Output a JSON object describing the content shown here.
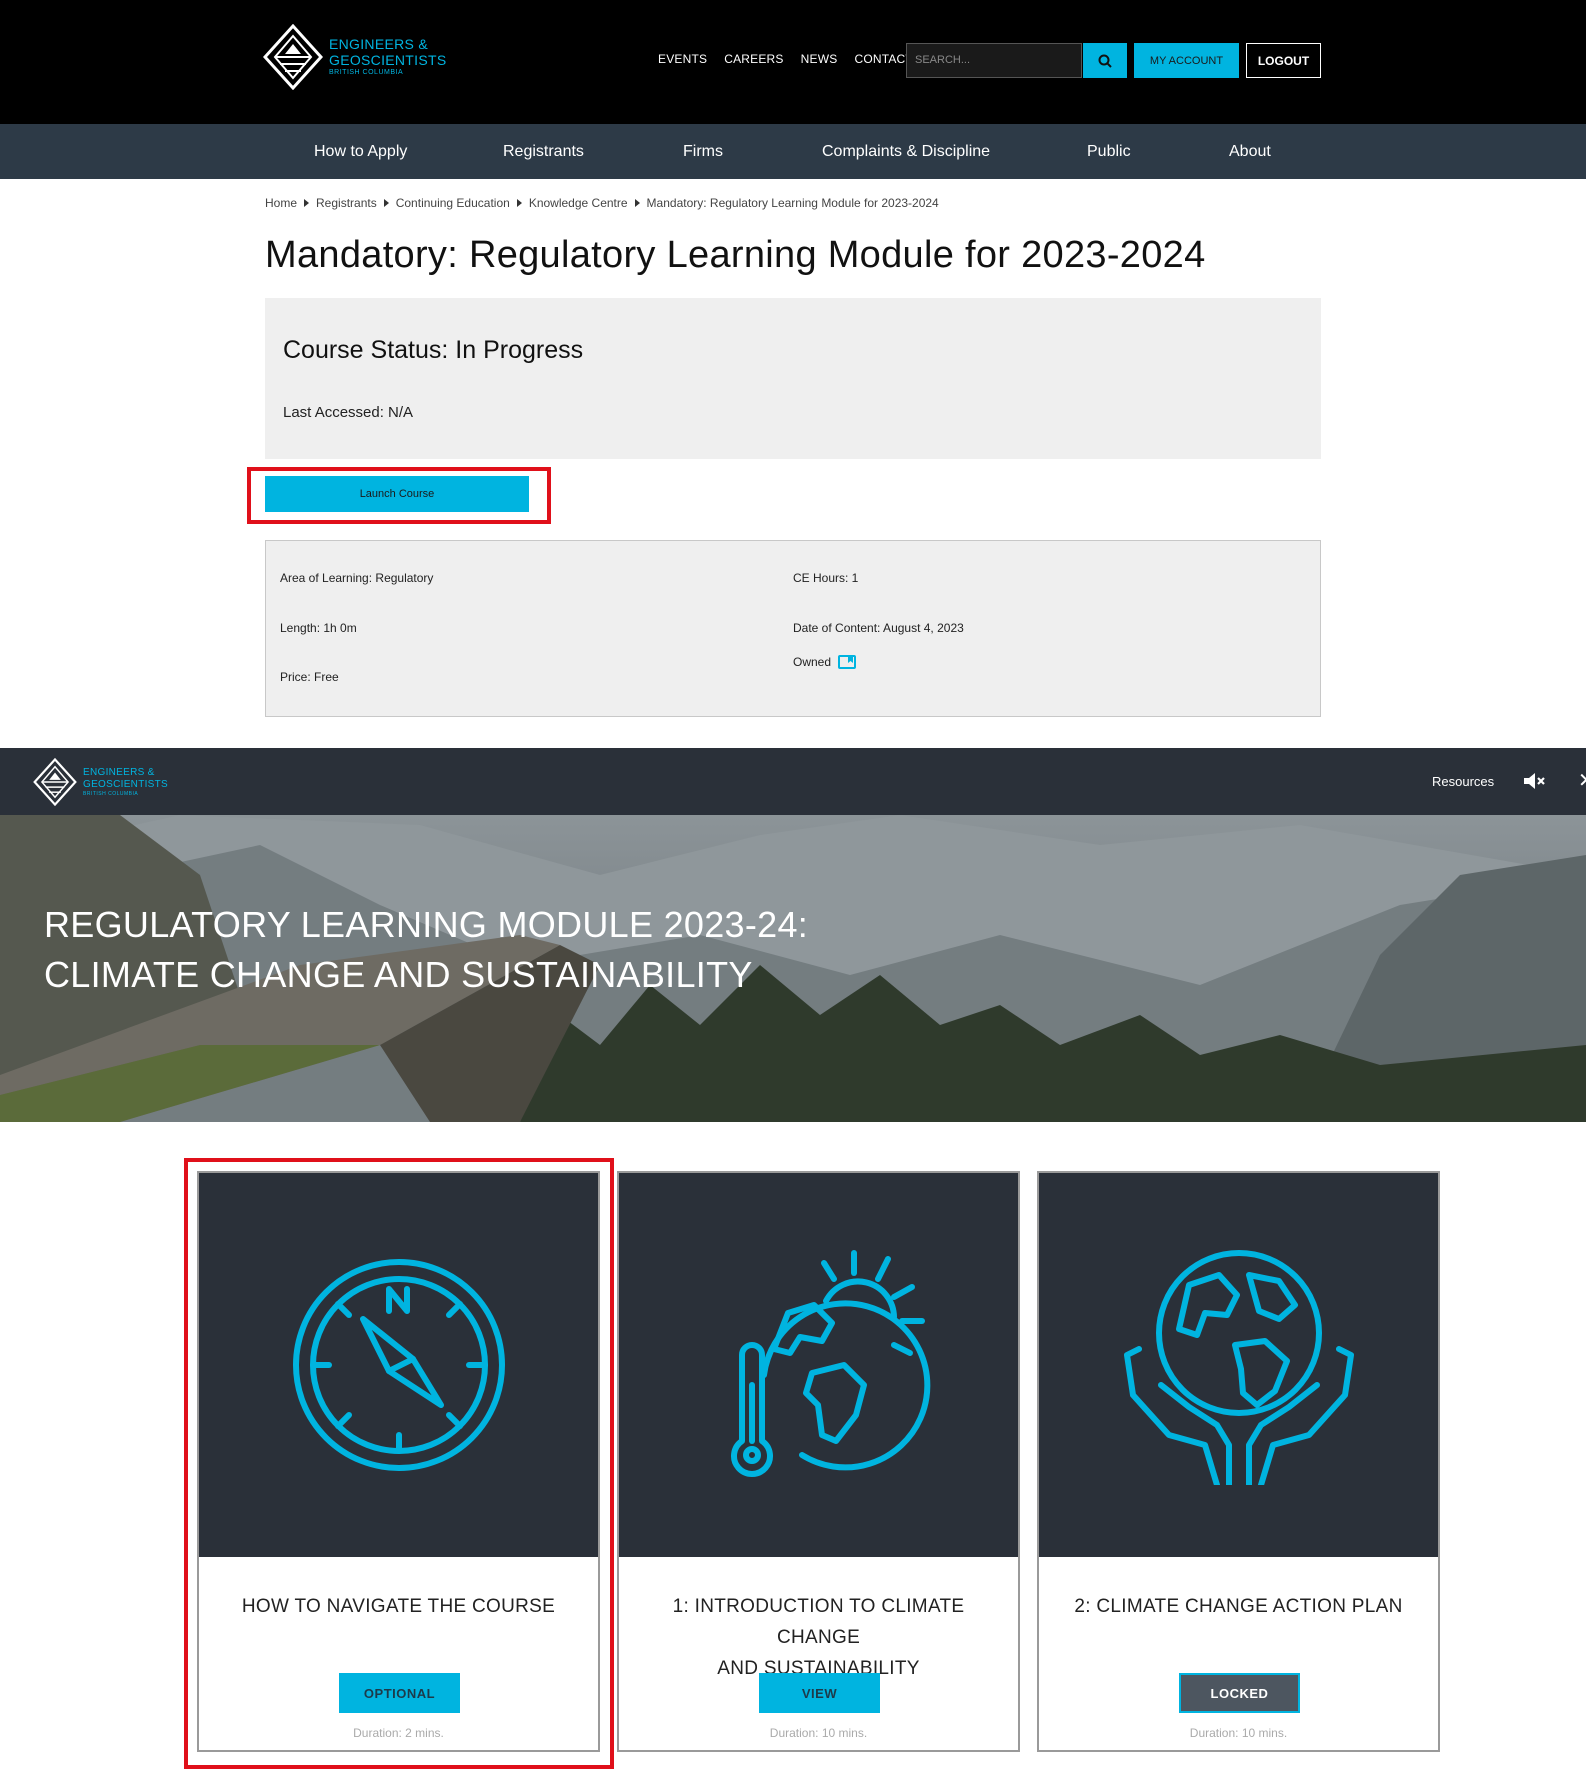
{
  "brand": {
    "line1": "ENGINEERS &",
    "line2": "GEOSCIENTISTS",
    "line3": "BRITISH COLUMBIA",
    "accent": "#00b4e0"
  },
  "header": {
    "util_links": [
      "EVENTS",
      "CAREERS",
      "NEWS",
      "CONTACT"
    ],
    "search_placeholder": "SEARCH...",
    "my_account": "MY ACCOUNT",
    "logout": "LOGOUT"
  },
  "main_nav": [
    "How to Apply",
    "Registrants",
    "Firms",
    "Complaints & Discipline",
    "Public",
    "About"
  ],
  "breadcrumb": [
    "Home",
    "Registrants",
    "Continuing Education",
    "Knowledge Centre",
    "Mandatory: Regulatory Learning Module for 2023-2024"
  ],
  "page_title": "Mandatory: Regulatory Learning Module for 2023-2024",
  "status": {
    "title": "Course Status: In Progress",
    "last_accessed": "Last Accessed: N/A"
  },
  "launch_label": "Launch Course",
  "details": {
    "area": "Area of Learning: Regulatory",
    "length": "Length: 1h 0m",
    "price": "Price: Free",
    "ce_hours": "CE Hours: 1",
    "date": "Date of Content: August 4, 2023",
    "owned": "Owned"
  },
  "player": {
    "resources": "Resources",
    "close": "✕",
    "hero_title_line1": "REGULATORY LEARNING MODULE 2023-24:",
    "hero_title_line2": "CLIMATE CHANGE AND SUSTAINABILITY"
  },
  "cards": [
    {
      "title": "HOW TO NAVIGATE THE COURSE",
      "button": "OPTIONAL",
      "duration": "Duration: 2 mins.",
      "icon": "compass-icon"
    },
    {
      "title_line1": "1: INTRODUCTION TO CLIMATE CHANGE",
      "title_line2": "AND SUSTAINABILITY",
      "button": "VIEW",
      "duration": "Duration: 10 mins.",
      "icon": "globe-thermometer-icon"
    },
    {
      "title": "2: CLIMATE CHANGE ACTION PLAN",
      "button": "LOCKED",
      "duration": "Duration: 10 mins.",
      "icon": "globe-hands-icon"
    }
  ]
}
